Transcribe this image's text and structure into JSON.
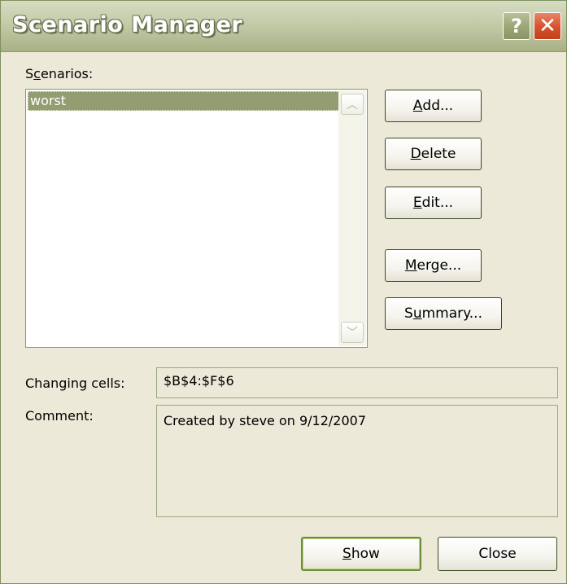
{
  "window": {
    "title": "Scenario Manager",
    "help_label": "?",
    "close_label": "✕"
  },
  "scenarios": {
    "label_pre": "S",
    "label_accel": "c",
    "label_post": "enarios:",
    "items": [
      "worst"
    ]
  },
  "scrollbar": {
    "up_icon": "chevron-up",
    "down_icon": "chevron-down"
  },
  "buttons": {
    "add": {
      "pre": "",
      "accel": "A",
      "post": "dd..."
    },
    "delete": {
      "pre": "",
      "accel": "D",
      "post": "elete"
    },
    "edit": {
      "pre": "",
      "accel": "E",
      "post": "dit..."
    },
    "merge": {
      "pre": "",
      "accel": "M",
      "post": "erge..."
    },
    "summary": {
      "pre": "S",
      "accel": "u",
      "post": "mmary..."
    },
    "show": {
      "pre": "",
      "accel": "S",
      "post": "how"
    },
    "close": {
      "label": "Close"
    }
  },
  "changing_cells": {
    "label": "Changing cells:",
    "value": "$B$4:$F$6"
  },
  "comment": {
    "label": "Comment:",
    "value": "Created by steve on 9/12/2007"
  },
  "colors": {
    "dialog_bg": "#ece9d8",
    "title_gradient_top": "#d6dcc0",
    "selection_bg": "#939d72",
    "close_button": "#d9542e",
    "button_border": "#3c4a1e"
  }
}
